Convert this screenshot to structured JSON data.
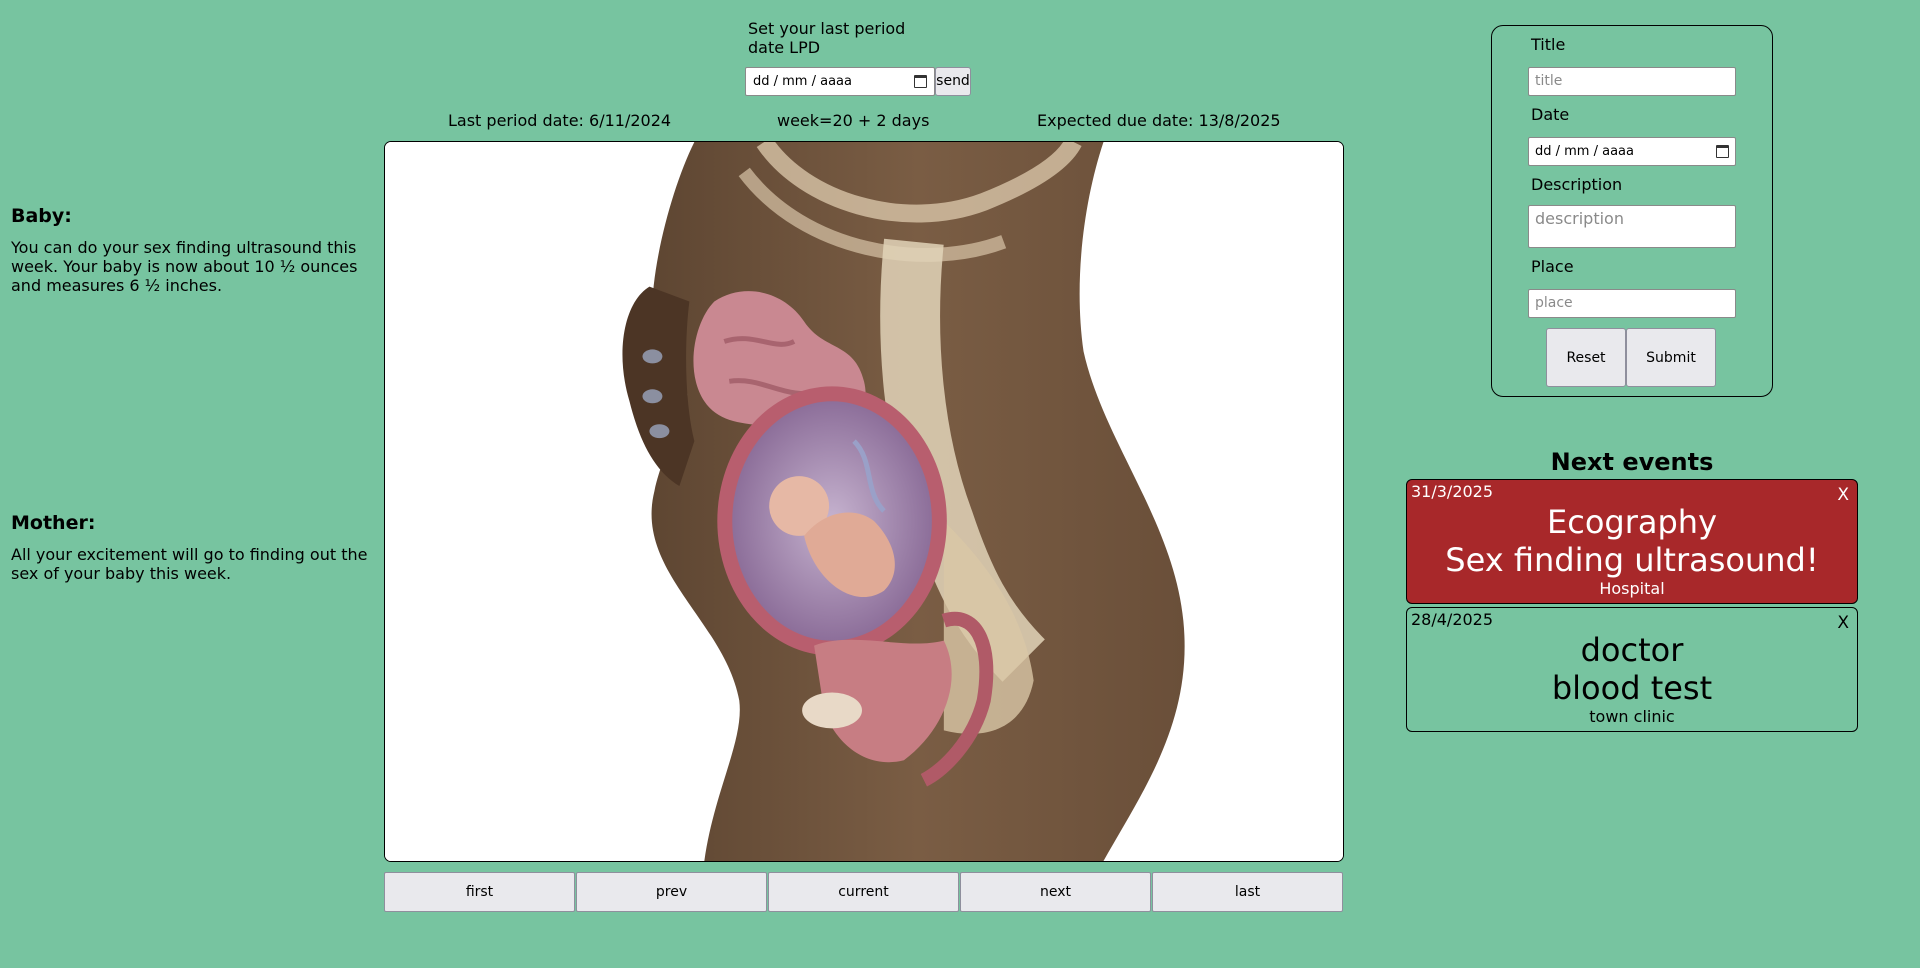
{
  "lpd_form": {
    "label": "Set your last period date LPD",
    "date_placeholder": "dd / mm / aaaa",
    "send_label": "send"
  },
  "info": {
    "last_period": "Last period date: 6/11/2024",
    "week": "week=20 + 2 days",
    "due_date": "Expected due date: 13/8/2025"
  },
  "illustration": {
    "icon": "pregnancy-anatomy-illustration"
  },
  "nav": {
    "first": "first",
    "prev": "prev",
    "current": "current",
    "next": "next",
    "last": "last"
  },
  "baby": {
    "heading": "Baby:",
    "text": "You can do your sex finding ultrasound this week. Your baby is now about 10 ½ ounces and measures 6 ½ inches."
  },
  "mother": {
    "heading": "Mother:",
    "text": "All your excitement will go to finding out the sex of your baby this week."
  },
  "event_form": {
    "title_label": "Title",
    "title_placeholder": "title",
    "date_label": "Date",
    "date_placeholder": "dd / mm / aaaa",
    "description_label": "Description",
    "description_placeholder": "description",
    "place_label": "Place",
    "place_placeholder": "place",
    "reset_label": "Reset",
    "submit_label": "Submit"
  },
  "events": {
    "title": "Next events",
    "items": [
      {
        "date": "31/3/2025",
        "close": "X",
        "type": "Ecography",
        "name": "Sex finding ultrasound!",
        "place": "Hospital",
        "color": "#a8282a"
      },
      {
        "date": "28/4/2025",
        "close": "X",
        "type": "doctor",
        "name": "blood test",
        "place": "town clinic"
      }
    ]
  },
  "colors": {
    "background": "#77c4a0",
    "highlight_event": "#a8282a",
    "button": "#e9e9ed"
  }
}
